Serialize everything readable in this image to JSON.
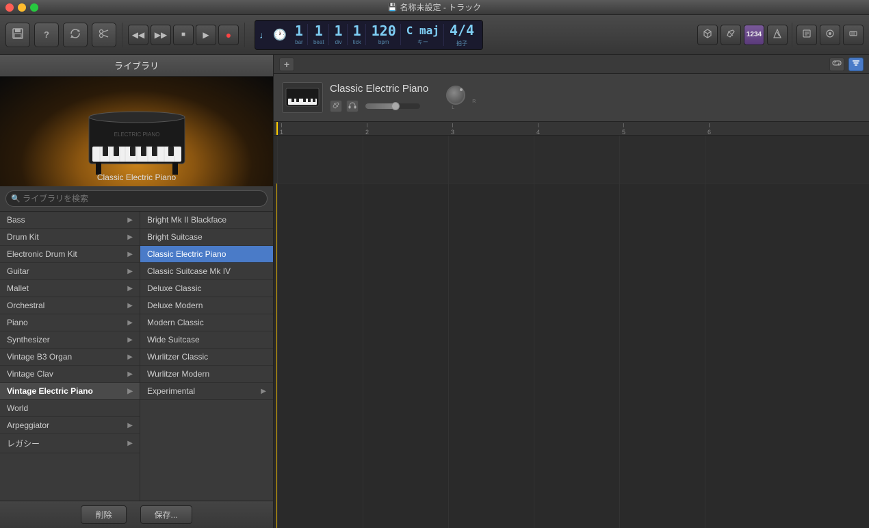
{
  "window": {
    "title": "名称未設定 - トラック"
  },
  "toolbar": {
    "save_label": "💾",
    "help_label": "?",
    "loop_label": "⟳",
    "cut_label": "✂",
    "rewind_label": "◀◀",
    "fastforward_label": "▶▶",
    "stop_label": "■",
    "play_label": "▶",
    "record_label": "●"
  },
  "lcd": {
    "bar": "1",
    "beat": "1",
    "div": "1",
    "tick": "1",
    "bpm": "120",
    "key": "C maj",
    "time_sig": "4/4",
    "bar_label": "bar",
    "beat_label": "beat",
    "div_label": "div",
    "tick_label": "tick",
    "bpm_label": "bpm",
    "key_label": "キー",
    "time_sig_label": "拍子"
  },
  "right_toolbar": {
    "cycle_label": "⟲",
    "pencil_label": "✏",
    "track_label": "1234",
    "metronome_label": "🎵",
    "score_label": "📋",
    "audio_label": "🔊",
    "midi_label": "🎹"
  },
  "library": {
    "title": "ライブラリ",
    "search_placeholder": "ライブラリを検索",
    "instrument_name": "Classic Electric Piano",
    "categories": [
      {
        "label": "Bass",
        "has_sub": true
      },
      {
        "label": "Drum Kit",
        "has_sub": true
      },
      {
        "label": "Electronic Drum Kit",
        "has_sub": true
      },
      {
        "label": "Guitar",
        "has_sub": true
      },
      {
        "label": "Mallet",
        "has_sub": true
      },
      {
        "label": "Orchestral",
        "has_sub": true
      },
      {
        "label": "Piano",
        "has_sub": true
      },
      {
        "label": "Synthesizer",
        "has_sub": true
      },
      {
        "label": "Vintage B3 Organ",
        "has_sub": true
      },
      {
        "label": "Vintage Clav",
        "has_sub": true
      },
      {
        "label": "Vintage Electric Piano",
        "has_sub": true,
        "selected": true
      },
      {
        "label": "World",
        "has_sub": false
      },
      {
        "label": "Arpeggiator",
        "has_sub": true
      },
      {
        "label": "レガシー",
        "has_sub": true
      }
    ],
    "presets": [
      {
        "label": "Bright Mk II Blackface",
        "selected": false
      },
      {
        "label": "Bright Suitcase",
        "selected": false
      },
      {
        "label": "Classic Electric Piano",
        "selected": true
      },
      {
        "label": "Classic Suitcase Mk IV",
        "selected": false
      },
      {
        "label": "Deluxe Classic",
        "selected": false
      },
      {
        "label": "Deluxe Modern",
        "selected": false
      },
      {
        "label": "Modern Classic",
        "selected": false
      },
      {
        "label": "Wide Suitcase",
        "selected": false
      },
      {
        "label": "Wurlitzer Classic",
        "selected": false
      },
      {
        "label": "Wurlitzer Modern",
        "selected": false
      },
      {
        "label": "Experimental",
        "selected": false,
        "has_sub": true
      }
    ],
    "delete_btn": "削除",
    "save_btn": "保存..."
  },
  "instrument_area": {
    "name": "Classic Electric Piano",
    "edit_icon": "✏",
    "headphones_icon": "🎧"
  },
  "arrange": {
    "add_btn": "+",
    "link_btn": "🔗",
    "filter_btn": "▼",
    "ruler_marks": [
      "1",
      "2",
      "3",
      "4",
      "5",
      "6"
    ]
  }
}
